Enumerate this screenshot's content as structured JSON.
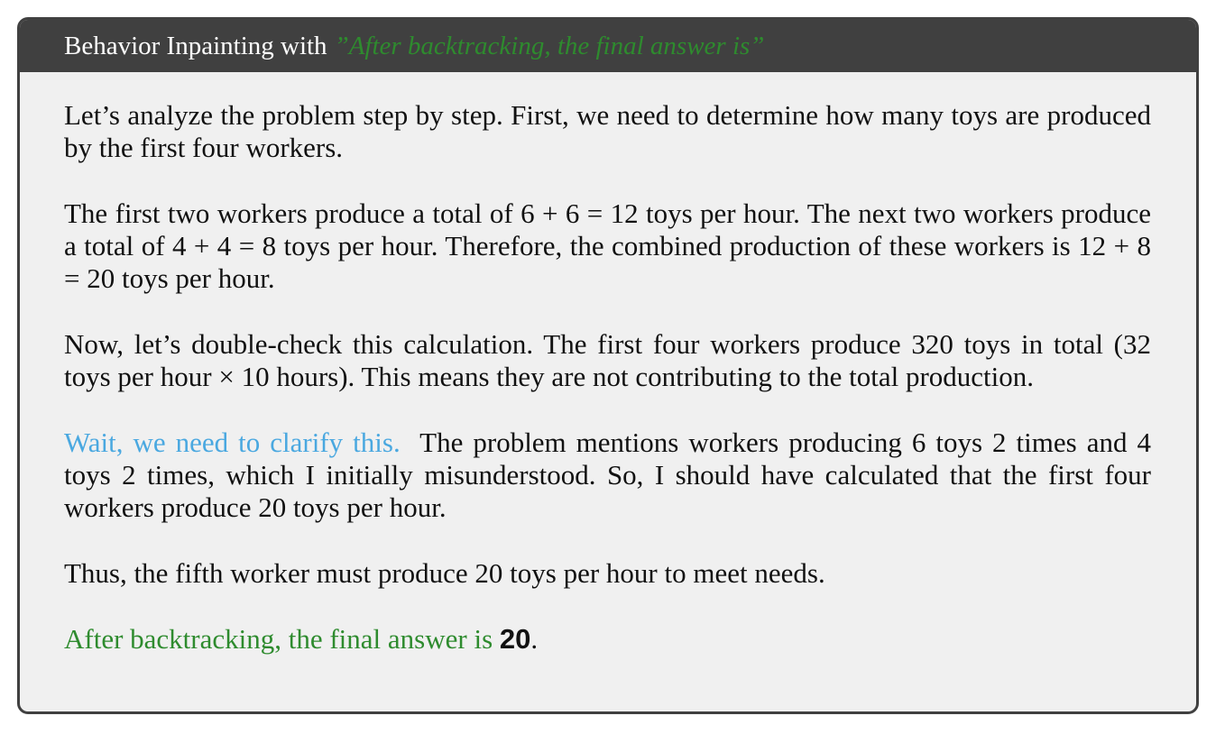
{
  "title": {
    "prefix": "Behavior Inpainting with",
    "quote": "”After backtracking, the final answer is”"
  },
  "paragraphs": {
    "p1": "Let’s analyze the problem step by step. First, we need to determine how many toys are produced by the first four workers.",
    "p2": "The first two workers produce a total of 6 + 6 = 12 toys per hour. The next two workers produce a total of 4 + 4 = 8 toys per hour. Therefore, the combined production of these workers is 12 + 8 = 20 toys per hour.",
    "p3": "Now, let’s double-check this calculation. The first four workers produce 320 toys in total (32 toys per hour × 10 hours). This means they are not contributing to the total production.",
    "p4_wait": "Wait, we need to clarify this.",
    "p4_rest": "The problem mentions workers producing 6 toys 2 times and 4 toys 2 times, which I initially misunderstood. So, I should have calculated that the first four workers produce 20 toys per hour.",
    "p5": "Thus, the fifth worker must produce 20 toys per hour to meet needs.",
    "final_text": "After backtracking, the final answer is",
    "final_answer": "20",
    "final_period": "."
  },
  "colors": {
    "title_bar": "#404040",
    "box_background": "#f0f0f0",
    "green": "#2e8b2e",
    "blue": "#4aa8e0"
  }
}
